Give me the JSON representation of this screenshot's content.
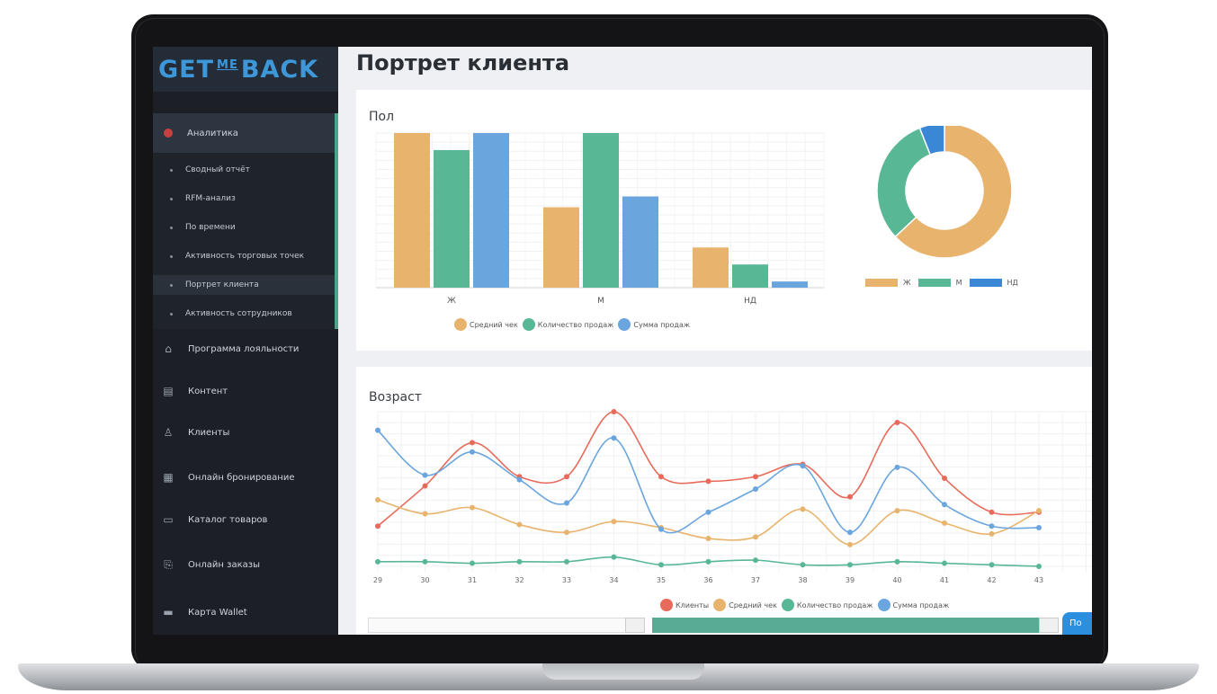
{
  "logo": {
    "get": "GET",
    "me": "ME",
    "back": "BACK"
  },
  "sidebar": {
    "analytics": "Аналитика",
    "sub_items": [
      "Сводный отчёт",
      "RFM-анализ",
      "По времени",
      "Активность торговых точек",
      "Портрет клиента",
      "Активность сотрудников"
    ],
    "main_items": [
      {
        "label": "Программа лояльности",
        "icon": "home-icon"
      },
      {
        "label": "Контент",
        "icon": "content-icon"
      },
      {
        "label": "Клиенты",
        "icon": "user-icon"
      },
      {
        "label": "Онлайн бронирование",
        "icon": "calendar-icon"
      },
      {
        "label": "Каталог товаров",
        "icon": "book-icon"
      },
      {
        "label": "Онлайн заказы",
        "icon": "order-icon"
      },
      {
        "label": "Карта Wallet",
        "icon": "card-icon"
      }
    ]
  },
  "page_title": "Портрет клиента",
  "gender_card": {
    "title": "Пол",
    "legend": [
      "Средний чек",
      "Количество продаж",
      "Сумма продаж"
    ],
    "donut_legend": [
      "Ж",
      "М",
      "НД"
    ]
  },
  "age_card": {
    "title": "Возраст",
    "legend": [
      "Клиенты",
      "Средний чек",
      "Количество продаж",
      "Сумма продаж"
    ]
  },
  "range": {
    "button_label": "По"
  },
  "colors": {
    "orange": "#e8b36c",
    "green": "#58b795",
    "blue": "#6aa5de",
    "red": "#e86a5a"
  },
  "chart_data": [
    {
      "type": "bar",
      "title": "Пол",
      "categories": [
        "Ж",
        "М",
        "НД"
      ],
      "ylim": [
        0,
        100
      ],
      "series": [
        {
          "name": "Средний чек",
          "values": [
            100,
            52,
            26
          ]
        },
        {
          "name": "Количество продаж",
          "values": [
            89,
            100,
            15
          ]
        },
        {
          "name": "Сумма продаж",
          "values": [
            100,
            59,
            4
          ]
        }
      ]
    },
    {
      "type": "pie",
      "categories": [
        "Ж",
        "М",
        "НД"
      ],
      "values": [
        63,
        31,
        6
      ]
    },
    {
      "type": "line",
      "title": "Возраст",
      "x": [
        29,
        30,
        31,
        32,
        33,
        34,
        35,
        36,
        37,
        38,
        39,
        40,
        41,
        42,
        43
      ],
      "ylim": [
        0,
        100
      ],
      "series": [
        {
          "name": "Клиенты",
          "values": [
            26,
            52,
            80,
            58,
            58,
            100,
            58,
            55,
            58,
            66,
            45,
            93,
            57,
            35,
            35
          ]
        },
        {
          "name": "Средний чек",
          "values": [
            43,
            34,
            38,
            27,
            22,
            29,
            25,
            18,
            19,
            37,
            14,
            36,
            28,
            21,
            36
          ]
        },
        {
          "name": "Количество продаж",
          "values": [
            3,
            3,
            2,
            3,
            3,
            6,
            1,
            3,
            4,
            1,
            1,
            3,
            2,
            1,
            0
          ]
        },
        {
          "name": "Сумма продаж",
          "values": [
            88,
            59,
            74,
            56,
            41,
            83,
            24,
            35,
            50,
            65,
            22,
            64,
            40,
            26,
            25
          ]
        }
      ]
    }
  ]
}
